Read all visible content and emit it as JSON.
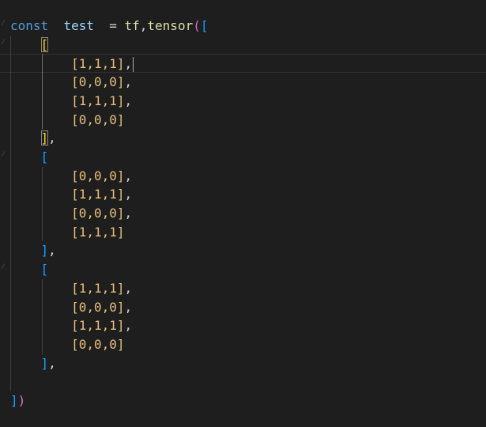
{
  "editor": {
    "lines": [
      {
        "tokens": [
          [
            "kw",
            "const"
          ],
          [
            "op",
            "  "
          ],
          [
            "var",
            "test"
          ],
          [
            "op",
            "  = "
          ],
          [
            "fn",
            "tf"
          ],
          [
            "op",
            ","
          ],
          [
            "fn",
            "tensor"
          ],
          [
            "br1",
            "("
          ],
          [
            "br2",
            "["
          ]
        ]
      },
      {
        "tokens": [
          [
            "op",
            "    "
          ],
          [
            "br3",
            "["
          ]
        ]
      },
      {
        "tokens": [
          [
            "op",
            "        "
          ],
          [
            "num",
            "[1,1,1]"
          ],
          [
            "op",
            ","
          ]
        ]
      },
      {
        "tokens": [
          [
            "op",
            "        "
          ],
          [
            "num",
            "[0,0,0]"
          ],
          [
            "op",
            ","
          ]
        ]
      },
      {
        "tokens": [
          [
            "op",
            "        "
          ],
          [
            "num",
            "[1,1,1]"
          ],
          [
            "op",
            ","
          ]
        ]
      },
      {
        "tokens": [
          [
            "op",
            "        "
          ],
          [
            "num",
            "[0,0,0]"
          ]
        ]
      },
      {
        "tokens": [
          [
            "op",
            "    "
          ],
          [
            "br3",
            "]"
          ],
          [
            "op",
            ","
          ]
        ]
      },
      {
        "tokens": [
          [
            "op",
            "    "
          ],
          [
            "br2",
            "["
          ]
        ]
      },
      {
        "tokens": [
          [
            "op",
            "        "
          ],
          [
            "num",
            "[0,0,0]"
          ],
          [
            "op",
            ","
          ]
        ]
      },
      {
        "tokens": [
          [
            "op",
            "        "
          ],
          [
            "num",
            "[1,1,1]"
          ],
          [
            "op",
            ","
          ]
        ]
      },
      {
        "tokens": [
          [
            "op",
            "        "
          ],
          [
            "num",
            "[0,0,0]"
          ],
          [
            "op",
            ","
          ]
        ]
      },
      {
        "tokens": [
          [
            "op",
            "        "
          ],
          [
            "num",
            "[1,1,1]"
          ]
        ]
      },
      {
        "tokens": [
          [
            "op",
            "    "
          ],
          [
            "br2",
            "]"
          ],
          [
            "op",
            ","
          ]
        ]
      },
      {
        "tokens": [
          [
            "op",
            "    "
          ],
          [
            "br2",
            "["
          ]
        ]
      },
      {
        "tokens": [
          [
            "op",
            "        "
          ],
          [
            "num",
            "[1,1,1]"
          ],
          [
            "op",
            ","
          ]
        ]
      },
      {
        "tokens": [
          [
            "op",
            "        "
          ],
          [
            "num",
            "[0,0,0]"
          ],
          [
            "op",
            ","
          ]
        ]
      },
      {
        "tokens": [
          [
            "op",
            "        "
          ],
          [
            "num",
            "[1,1,1]"
          ],
          [
            "op",
            ","
          ]
        ]
      },
      {
        "tokens": [
          [
            "op",
            "        "
          ],
          [
            "num",
            "[0,0,0]"
          ]
        ]
      },
      {
        "tokens": [
          [
            "op",
            "    "
          ],
          [
            "br2",
            "]"
          ],
          [
            "op",
            ","
          ]
        ]
      },
      {
        "tokens": []
      },
      {
        "tokens": [
          [
            "br2",
            "]"
          ],
          [
            "br1",
            ")"
          ]
        ]
      }
    ],
    "colors": {
      "background": "#1e1e1e",
      "keyword": "#569cd6",
      "variable": "#9cdcfe",
      "function": "#dcdcaa",
      "bracket_level1": "#da70d6",
      "bracket_level2": "#179fff",
      "bracket_level3": "#ffd700",
      "number": "#e6c07b"
    }
  }
}
